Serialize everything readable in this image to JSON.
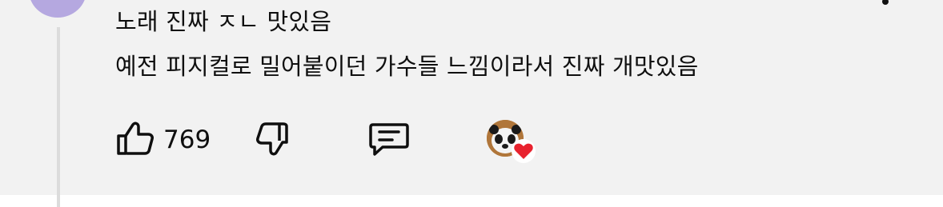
{
  "comment": {
    "line1": "노래 진짜 ㅈㄴ 맛있음",
    "line2": "예전 피지컬로 밀어붙이던 가수들 느낌이라서 진짜 개맛있음"
  },
  "actions": {
    "like_count": "769"
  },
  "icons": {
    "like": "thumbs-up-icon",
    "dislike": "thumbs-down-icon",
    "reply": "comment-icon",
    "creator_heart": "creator-heart-icon"
  },
  "colors": {
    "panel_bg": "#f2f2f2",
    "avatar": "#b5a8e0",
    "heart": "#e8222e"
  }
}
